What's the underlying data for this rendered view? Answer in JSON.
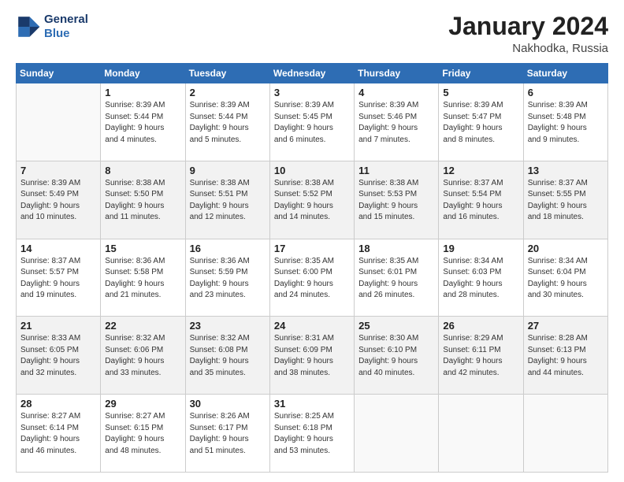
{
  "header": {
    "logo_line1": "General",
    "logo_line2": "Blue",
    "title": "January 2024",
    "subtitle": "Nakhodka, Russia"
  },
  "columns": [
    "Sunday",
    "Monday",
    "Tuesday",
    "Wednesday",
    "Thursday",
    "Friday",
    "Saturday"
  ],
  "weeks": [
    [
      {
        "day": "",
        "info": ""
      },
      {
        "day": "1",
        "info": "Sunrise: 8:39 AM\nSunset: 5:44 PM\nDaylight: 9 hours\nand 4 minutes."
      },
      {
        "day": "2",
        "info": "Sunrise: 8:39 AM\nSunset: 5:44 PM\nDaylight: 9 hours\nand 5 minutes."
      },
      {
        "day": "3",
        "info": "Sunrise: 8:39 AM\nSunset: 5:45 PM\nDaylight: 9 hours\nand 6 minutes."
      },
      {
        "day": "4",
        "info": "Sunrise: 8:39 AM\nSunset: 5:46 PM\nDaylight: 9 hours\nand 7 minutes."
      },
      {
        "day": "5",
        "info": "Sunrise: 8:39 AM\nSunset: 5:47 PM\nDaylight: 9 hours\nand 8 minutes."
      },
      {
        "day": "6",
        "info": "Sunrise: 8:39 AM\nSunset: 5:48 PM\nDaylight: 9 hours\nand 9 minutes."
      }
    ],
    [
      {
        "day": "7",
        "info": ""
      },
      {
        "day": "8",
        "info": "Sunrise: 8:38 AM\nSunset: 5:50 PM\nDaylight: 9 hours\nand 11 minutes."
      },
      {
        "day": "9",
        "info": "Sunrise: 8:38 AM\nSunset: 5:51 PM\nDaylight: 9 hours\nand 12 minutes."
      },
      {
        "day": "10",
        "info": "Sunrise: 8:38 AM\nSunset: 5:52 PM\nDaylight: 9 hours\nand 14 minutes."
      },
      {
        "day": "11",
        "info": "Sunrise: 8:38 AM\nSunset: 5:53 PM\nDaylight: 9 hours\nand 15 minutes."
      },
      {
        "day": "12",
        "info": "Sunrise: 8:37 AM\nSunset: 5:54 PM\nDaylight: 9 hours\nand 16 minutes."
      },
      {
        "day": "13",
        "info": "Sunrise: 8:37 AM\nSunset: 5:55 PM\nDaylight: 9 hours\nand 18 minutes."
      }
    ],
    [
      {
        "day": "14",
        "info": ""
      },
      {
        "day": "15",
        "info": "Sunrise: 8:36 AM\nSunset: 5:58 PM\nDaylight: 9 hours\nand 21 minutes."
      },
      {
        "day": "16",
        "info": "Sunrise: 8:36 AM\nSunset: 5:59 PM\nDaylight: 9 hours\nand 23 minutes."
      },
      {
        "day": "17",
        "info": "Sunrise: 8:35 AM\nSunset: 6:00 PM\nDaylight: 9 hours\nand 24 minutes."
      },
      {
        "day": "18",
        "info": "Sunrise: 8:35 AM\nSunset: 6:01 PM\nDaylight: 9 hours\nand 26 minutes."
      },
      {
        "day": "19",
        "info": "Sunrise: 8:34 AM\nSunset: 6:03 PM\nDaylight: 9 hours\nand 28 minutes."
      },
      {
        "day": "20",
        "info": "Sunrise: 8:34 AM\nSunset: 6:04 PM\nDaylight: 9 hours\nand 30 minutes."
      }
    ],
    [
      {
        "day": "21",
        "info": "Sunrise: 8:33 AM\nSunset: 6:05 PM\nDaylight: 9 hours\nand 32 minutes."
      },
      {
        "day": "22",
        "info": "Sunrise: 8:32 AM\nSunset: 6:06 PM\nDaylight: 9 hours\nand 33 minutes."
      },
      {
        "day": "23",
        "info": "Sunrise: 8:32 AM\nSunset: 6:08 PM\nDaylight: 9 hours\nand 35 minutes."
      },
      {
        "day": "24",
        "info": "Sunrise: 8:31 AM\nSunset: 6:09 PM\nDaylight: 9 hours\nand 38 minutes."
      },
      {
        "day": "25",
        "info": "Sunrise: 8:30 AM\nSunset: 6:10 PM\nDaylight: 9 hours\nand 40 minutes."
      },
      {
        "day": "26",
        "info": "Sunrise: 8:29 AM\nSunset: 6:11 PM\nDaylight: 9 hours\nand 42 minutes."
      },
      {
        "day": "27",
        "info": "Sunrise: 8:28 AM\nSunset: 6:13 PM\nDaylight: 9 hours\nand 44 minutes."
      }
    ],
    [
      {
        "day": "28",
        "info": "Sunrise: 8:27 AM\nSunset: 6:14 PM\nDaylight: 9 hours\nand 46 minutes."
      },
      {
        "day": "29",
        "info": "Sunrise: 8:27 AM\nSunset: 6:15 PM\nDaylight: 9 hours\nand 48 minutes."
      },
      {
        "day": "30",
        "info": "Sunrise: 8:26 AM\nSunset: 6:17 PM\nDaylight: 9 hours\nand 51 minutes."
      },
      {
        "day": "31",
        "info": "Sunrise: 8:25 AM\nSunset: 6:18 PM\nDaylight: 9 hours\nand 53 minutes."
      },
      {
        "day": "",
        "info": ""
      },
      {
        "day": "",
        "info": ""
      },
      {
        "day": "",
        "info": ""
      }
    ]
  ],
  "week7_sunday": {
    "info": "Sunrise: 8:39 AM\nSunset: 5:49 PM\nDaylight: 9 hours\nand 10 minutes."
  },
  "week14_sunday": {
    "info": "Sunrise: 8:37 AM\nSunset: 5:57 PM\nDaylight: 9 hours\nand 19 minutes."
  }
}
